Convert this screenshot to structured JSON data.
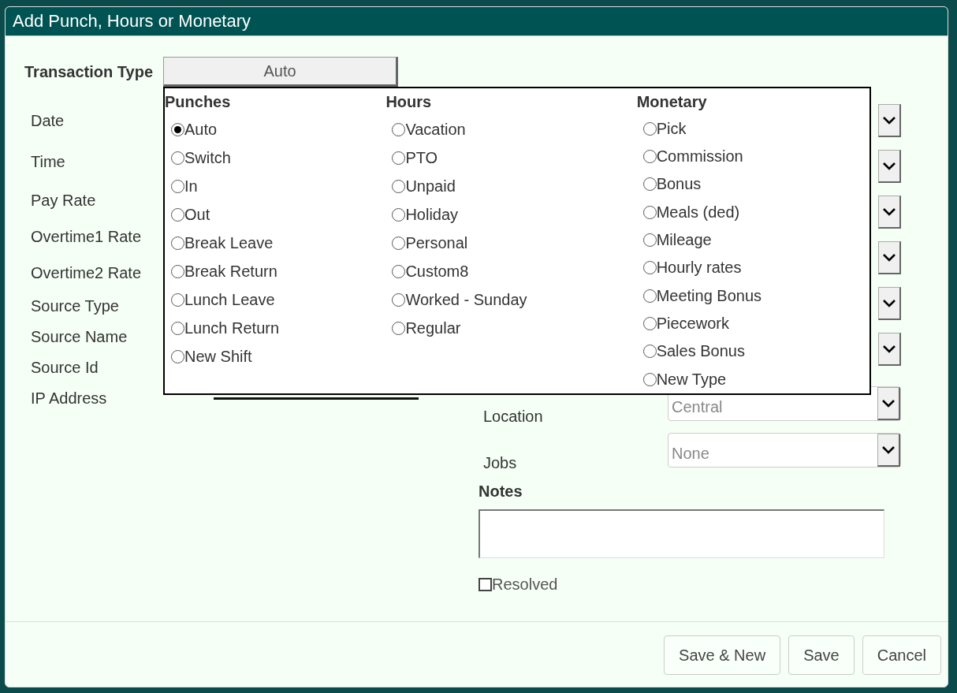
{
  "window": {
    "title": "Add Punch, Hours or Monetary"
  },
  "transaction_type": {
    "label": "Transaction Type",
    "value": "Auto"
  },
  "field_labels": [
    "Date",
    "Time",
    "Pay Rate",
    "Overtime1 Rate",
    "Overtime2 Rate",
    "Source Type",
    "Source Name",
    "Source Id",
    "IP Address"
  ],
  "type_menu": {
    "columns": [
      {
        "heading": "Punches",
        "options": [
          {
            "label": "Auto",
            "selected": true
          },
          {
            "label": "Switch",
            "selected": false
          },
          {
            "label": "In",
            "selected": false
          },
          {
            "label": "Out",
            "selected": false
          },
          {
            "label": "Break Leave",
            "selected": false
          },
          {
            "label": "Break Return",
            "selected": false
          },
          {
            "label": "Lunch Leave",
            "selected": false
          },
          {
            "label": "Lunch Return",
            "selected": false
          },
          {
            "label": "New Shift",
            "selected": false
          }
        ]
      },
      {
        "heading": "Hours",
        "options": [
          {
            "label": "Vacation",
            "selected": false
          },
          {
            "label": "PTO",
            "selected": false
          },
          {
            "label": "Unpaid",
            "selected": false
          },
          {
            "label": "Holiday",
            "selected": false
          },
          {
            "label": "Personal",
            "selected": false
          },
          {
            "label": "Custom8",
            "selected": false
          },
          {
            "label": "Worked - Sunday",
            "selected": false
          },
          {
            "label": "Regular",
            "selected": false
          }
        ]
      },
      {
        "heading": "Monetary",
        "options": [
          {
            "label": "Pick",
            "selected": false
          },
          {
            "label": "Commission",
            "selected": false
          },
          {
            "label": "Bonus",
            "selected": false
          },
          {
            "label": "Meals (ded)",
            "selected": false
          },
          {
            "label": "Mileage",
            "selected": false
          },
          {
            "label": "Hourly rates",
            "selected": false
          },
          {
            "label": "Meeting Bonus",
            "selected": false
          },
          {
            "label": "Piecework",
            "selected": false
          },
          {
            "label": "Sales Bonus",
            "selected": false
          },
          {
            "label": "New Type",
            "selected": false
          }
        ]
      }
    ]
  },
  "right_selects": [
    {
      "kind": "covered"
    },
    {
      "kind": "covered"
    },
    {
      "kind": "covered"
    },
    {
      "kind": "covered"
    },
    {
      "kind": "covered"
    },
    {
      "kind": "covered"
    },
    {
      "kind": "full",
      "label": "Location",
      "value": "Central"
    },
    {
      "kind": "full",
      "label": "Jobs",
      "value": "None"
    }
  ],
  "notes": {
    "label": "Notes"
  },
  "resolved": {
    "label": "Resolved",
    "checked": false
  },
  "buttons": [
    "Save & New",
    "Save",
    "Cancel"
  ]
}
